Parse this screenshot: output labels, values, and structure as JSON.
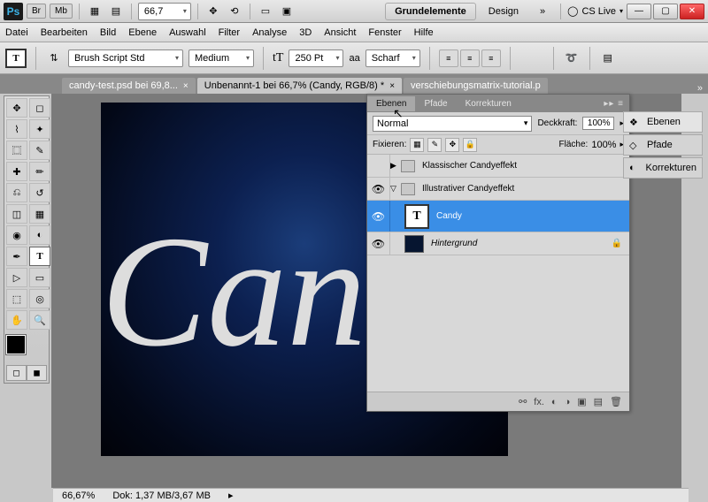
{
  "titlebar": {
    "br": "Br",
    "mb": "Mb",
    "zoom": "66,7",
    "modes": {
      "active": "Grundelemente",
      "design": "Design",
      "more": "»"
    },
    "cslive": "CS Live"
  },
  "menu": [
    "Datei",
    "Bearbeiten",
    "Bild",
    "Ebene",
    "Auswahl",
    "Filter",
    "Analyse",
    "3D",
    "Ansicht",
    "Fenster",
    "Hilfe"
  ],
  "options": {
    "font": "Brush Script Std",
    "weight": "Medium",
    "size": "250 Pt",
    "aa_label": "aa",
    "aa": "Scharf"
  },
  "doctabs": [
    {
      "label": "candy-test.psd bei 69,8...",
      "active": false
    },
    {
      "label": "Unbenannt-1 bei 66,7% (Candy, RGB/8) *",
      "active": true
    },
    {
      "label": "verschiebungsmatrix-tutorial.p",
      "active": false
    }
  ],
  "canvas_text": "Can",
  "status": {
    "zoom": "66,67%",
    "doc": "Dok: 1,37 MB/3,67 MB"
  },
  "layers_panel": {
    "tabs": [
      "Ebenen",
      "Pfade",
      "Korrekturen"
    ],
    "blend": "Normal",
    "opacity_label": "Deckkraft:",
    "opacity": "100%",
    "lock_label": "Fixieren:",
    "fill_label": "Fläche:",
    "fill": "100%",
    "layers": [
      {
        "type": "group",
        "name": "Klassischer Candyeffekt",
        "open": false,
        "visible": false
      },
      {
        "type": "group",
        "name": "Illustrativer Candyeffekt",
        "open": true,
        "visible": true
      },
      {
        "type": "text",
        "name": "Candy",
        "selected": true,
        "visible": true,
        "indent": 1
      },
      {
        "type": "raster",
        "name": "Hintergrund",
        "locked": true,
        "visible": true
      }
    ]
  },
  "right_panels": [
    {
      "label": "Ebenen",
      "icon": "❖",
      "active": true
    },
    {
      "label": "Pfade",
      "icon": "◇",
      "active": false
    },
    {
      "label": "Korrekturen",
      "icon": "◐",
      "active": false
    }
  ]
}
